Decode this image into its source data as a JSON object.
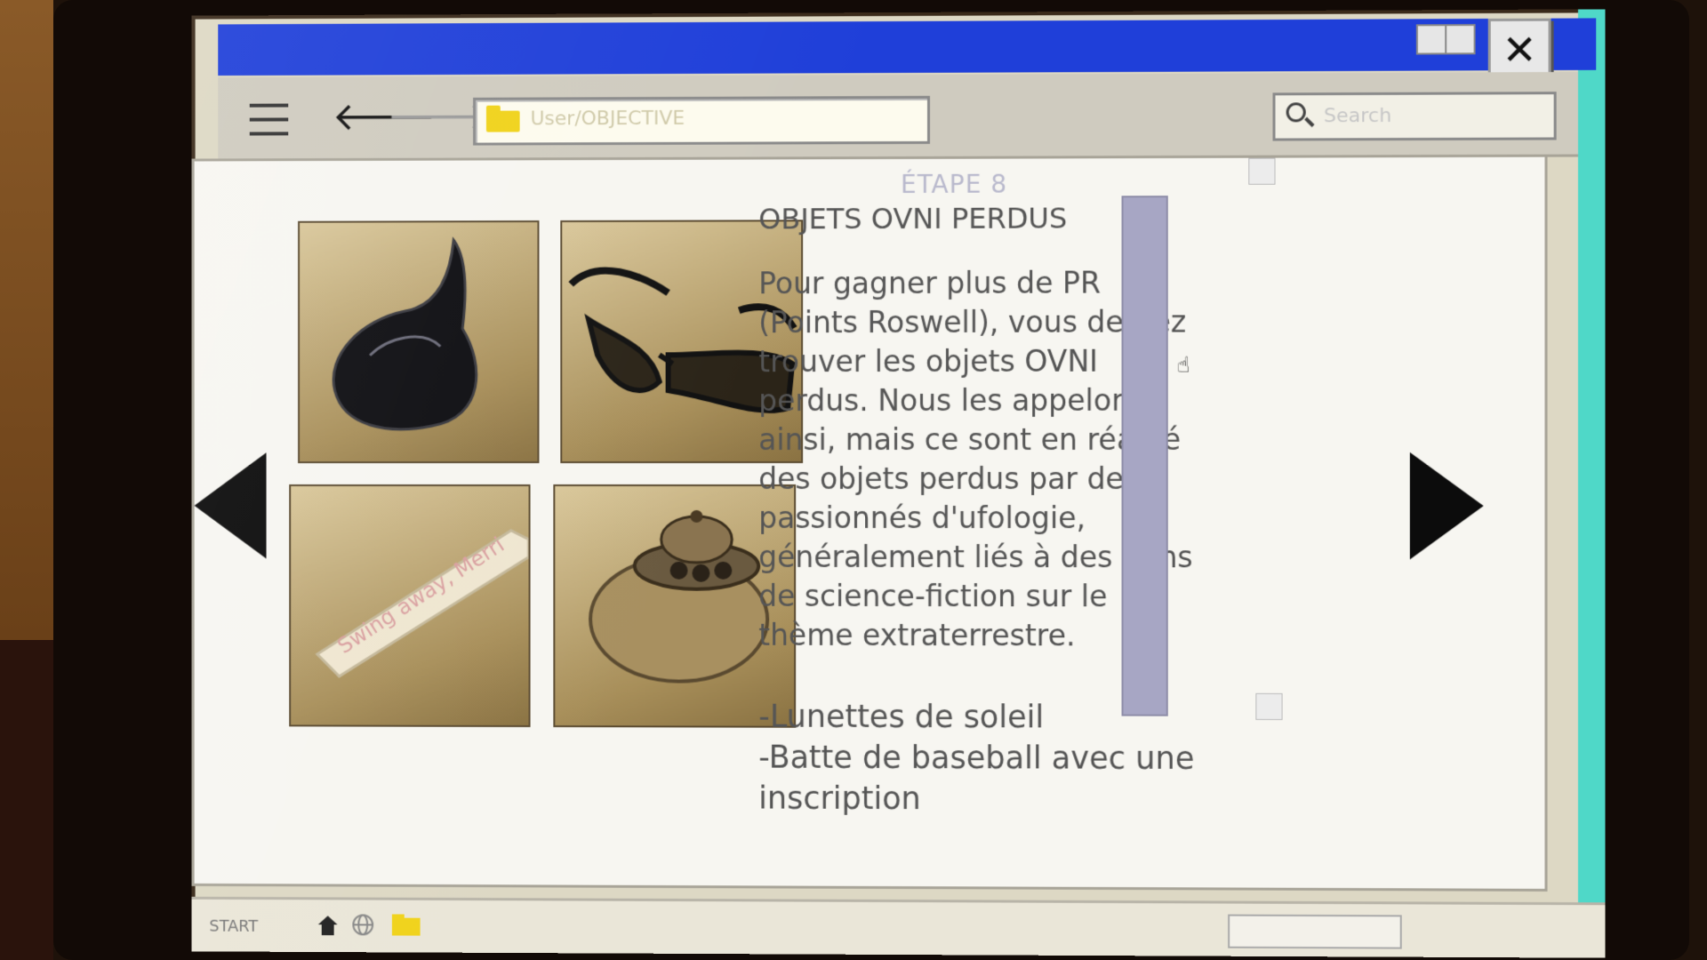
{
  "window": {
    "close_symbol": "✕",
    "colors": {
      "titlebar": "#1f3fd9",
      "accent_strip": "#4fd8c8"
    }
  },
  "toolbar": {
    "menu_icon": "hamburger-icon",
    "back_arrow": "🡐",
    "forward_arrow": "🡒",
    "address_path": "User/OBJECTIVE",
    "search_placeholder": "Search"
  },
  "content": {
    "step": "ÉTAPE 8",
    "heading": "OBJETS OVNI PERDUS",
    "body_lines": [
      "Pour gagner plus de PR",
      "(Points Roswell), vous devrez",
      "trouver les objets OVNI",
      "perdus. Nous les appelons",
      "ainsi, mais ce sont en réalité",
      "des objets perdus par des",
      "passionnés d'ufologie,",
      "généralement liés à des films",
      "de science-fiction sur le",
      "thème extraterrestre."
    ],
    "items": [
      "-Lunettes de soleil",
      "-Batte de baseball avec une",
      "inscription"
    ],
    "images": [
      {
        "name": "hat-icon",
        "desc": "black pointed hat"
      },
      {
        "name": "sunglasses-icon",
        "desc": "sunglasses"
      },
      {
        "name": "bat-icon",
        "inscription": "Swing away, Merri"
      },
      {
        "name": "ufo-icon",
        "desc": "flying saucer"
      }
    ]
  },
  "taskbar": {
    "start_label": "START"
  }
}
